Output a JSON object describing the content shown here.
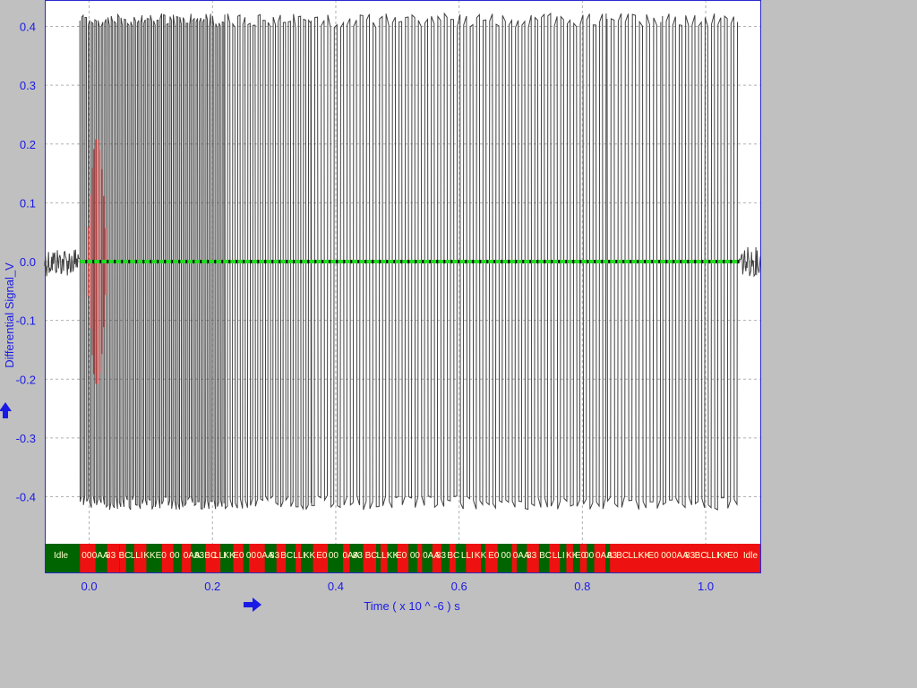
{
  "colors": {
    "background": "#c0c0c0",
    "plot_bg": "#ffffff",
    "plot_border": "#2a2acc",
    "axis_text": "#1a1ae6",
    "waveform": "#404040",
    "highlight": "#ff2020",
    "threshold_line": "#22dd22",
    "decode_idle": "#006400",
    "decode_active": "#ee1111",
    "decode_text": "#ffffcc"
  },
  "icons": {
    "y_arrow": "up-arrow-icon",
    "x_arrow": "right-arrow-icon"
  },
  "chart_data": {
    "type": "line",
    "title": "",
    "xlabel": "Time  ( x 10 ^ -6 ) s",
    "ylabel": "Differential Signal_V",
    "xlim": [
      -0.072,
      1.09
    ],
    "ylim": [
      -0.48,
      0.445
    ],
    "x_ticks": [
      {
        "value": 0.0,
        "label": "0.0"
      },
      {
        "value": 0.2,
        "label": "0.2"
      },
      {
        "value": 0.4,
        "label": "0.4"
      },
      {
        "value": 0.6,
        "label": "0.6"
      },
      {
        "value": 0.8,
        "label": "0.8"
      },
      {
        "value": 1.0,
        "label": "1.0"
      }
    ],
    "y_ticks": [
      {
        "value": 0.4,
        "label": "0.4"
      },
      {
        "value": 0.3,
        "label": "0.3"
      },
      {
        "value": 0.2,
        "label": "0.2"
      },
      {
        "value": 0.1,
        "label": "0.1"
      },
      {
        "value": 0.0,
        "label": "0.0"
      },
      {
        "value": -0.1,
        "label": "-0.1"
      },
      {
        "value": -0.2,
        "label": "-0.2"
      },
      {
        "value": -0.3,
        "label": "-0.3"
      },
      {
        "value": -0.4,
        "label": "-0.4"
      }
    ],
    "grid": true,
    "signal": {
      "high_v": 0.41,
      "low_v": -0.41,
      "idle_noise_v": 0.025,
      "segments": [
        {
          "t_start": -0.072,
          "t_end": -0.015,
          "kind": "idle"
        },
        {
          "t_start": -0.015,
          "t_end": 0.22,
          "kind": "toggle",
          "period": 0.0053
        },
        {
          "t_start": 0.22,
          "t_end": 0.36,
          "kind": "toggle",
          "period": 0.0082
        },
        {
          "t_start": 0.36,
          "t_end": 0.84,
          "kind": "toggle",
          "period": 0.0105
        },
        {
          "t_start": 0.84,
          "t_end": 0.93,
          "kind": "toggle",
          "period": 0.0115
        },
        {
          "t_start": 0.93,
          "t_end": 1.055,
          "kind": "toggle",
          "period": 0.0105
        },
        {
          "t_start": 1.055,
          "t_end": 1.09,
          "kind": "idle"
        }
      ],
      "highlight_window": [
        -0.005,
        0.03
      ]
    },
    "threshold": {
      "value": 0.0,
      "t_start": -0.015,
      "t_end": 1.055
    },
    "decode_bar": {
      "idle_start_label": "Idle",
      "idle_end_label": "Idle",
      "fragments": [
        "00",
        "0AA",
        "83",
        "BC",
        "LLI",
        "KK",
        "E0"
      ],
      "ranges": [
        {
          "t_start": -0.072,
          "t_end": -0.015,
          "state": "idle"
        },
        {
          "t_start": -0.015,
          "t_end": 0.05,
          "state": "mixed"
        },
        {
          "t_start": 0.05,
          "t_end": 0.5,
          "state": "mixed"
        },
        {
          "t_start": 0.5,
          "t_end": 0.71,
          "state": "mixed"
        },
        {
          "t_start": 0.71,
          "t_end": 0.845,
          "state": "idle-ish"
        },
        {
          "t_start": 0.845,
          "t_end": 1.055,
          "state": "active"
        },
        {
          "t_start": 1.055,
          "t_end": 1.09,
          "state": "idle-end"
        }
      ]
    }
  }
}
